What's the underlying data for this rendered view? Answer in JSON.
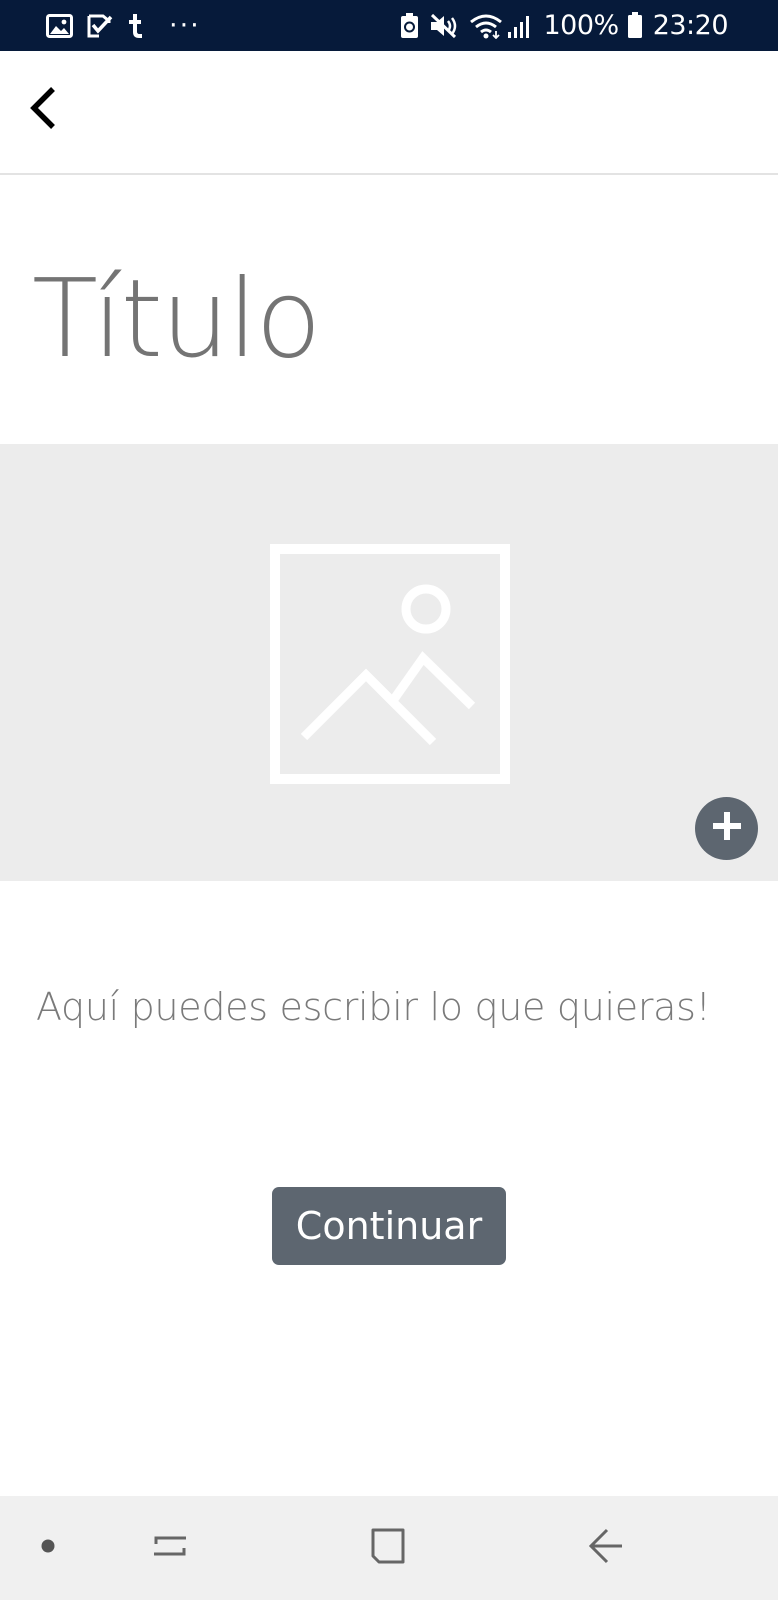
{
  "status_bar": {
    "left_icons": [
      "gallery-icon",
      "task-check-icon",
      "tumblr-icon",
      "more-dots-icon"
    ],
    "more_label": "···",
    "right_icons": [
      "battery-saver-icon",
      "mute-icon",
      "wifi-icon",
      "signal-icon",
      "battery-icon"
    ],
    "battery": "100%",
    "time": "23:20",
    "background": "#061a3a"
  },
  "app_bar": {
    "back_icon": "chevron-left-icon"
  },
  "main": {
    "title": "Título",
    "image_placeholder_icon": "image-placeholder-icon",
    "add_image_icon": "plus-icon",
    "body_text": "Aquí puedes escribir lo que quieras!",
    "continue_label": "Continuar"
  },
  "colors": {
    "accent": "#5d6670",
    "image_area_bg": "#ececec",
    "text_muted": "#747474"
  },
  "nav_bar": {
    "items": [
      "dot-icon",
      "recent-apps-icon",
      "home-icon",
      "back-arrow-icon"
    ]
  }
}
